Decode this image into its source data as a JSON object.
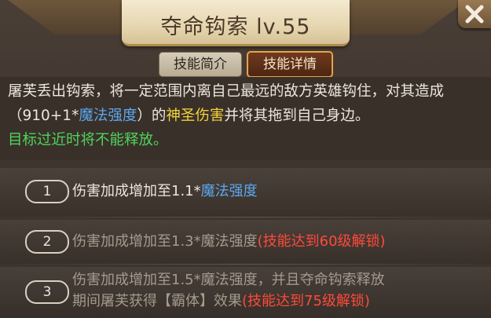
{
  "title": "夺命钩索 lv.55",
  "close_icon": "close-x-icon",
  "tabs": {
    "intro": "技能简介",
    "detail": "技能详情"
  },
  "description": {
    "part1": "屠芙丢出钩索，将一定范围内离自己最远的敌方英雄钩住，对其造成（910+1*",
    "stat": "魔法强度",
    "part2": "）的",
    "damage_type": "神圣伤害",
    "part3": "并将其拖到自己身边。",
    "note": "目标过近时将不能释放。"
  },
  "upgrades": [
    {
      "number": "1",
      "text": "伤害加成增加至1.1*",
      "stat": "魔法强度",
      "unlocked": true
    },
    {
      "number": "2",
      "text": "伤害加成增加至1.3*魔法强度",
      "lock": "(技能达到60级解锁)",
      "unlocked": false
    },
    {
      "number": "3",
      "line1": "伤害加成增加至1.5*魔法强度，并且夺命钩索释放",
      "line2": "期间屠芙获得【霸体】效果",
      "lock": "(技能达到75级解锁)",
      "unlocked": false
    }
  ],
  "colors": {
    "stat_blue": "#5aa8f0",
    "holy_gold": "#f0d23a",
    "note_green": "#4ed45a",
    "lock_red": "#ff4a3a"
  }
}
